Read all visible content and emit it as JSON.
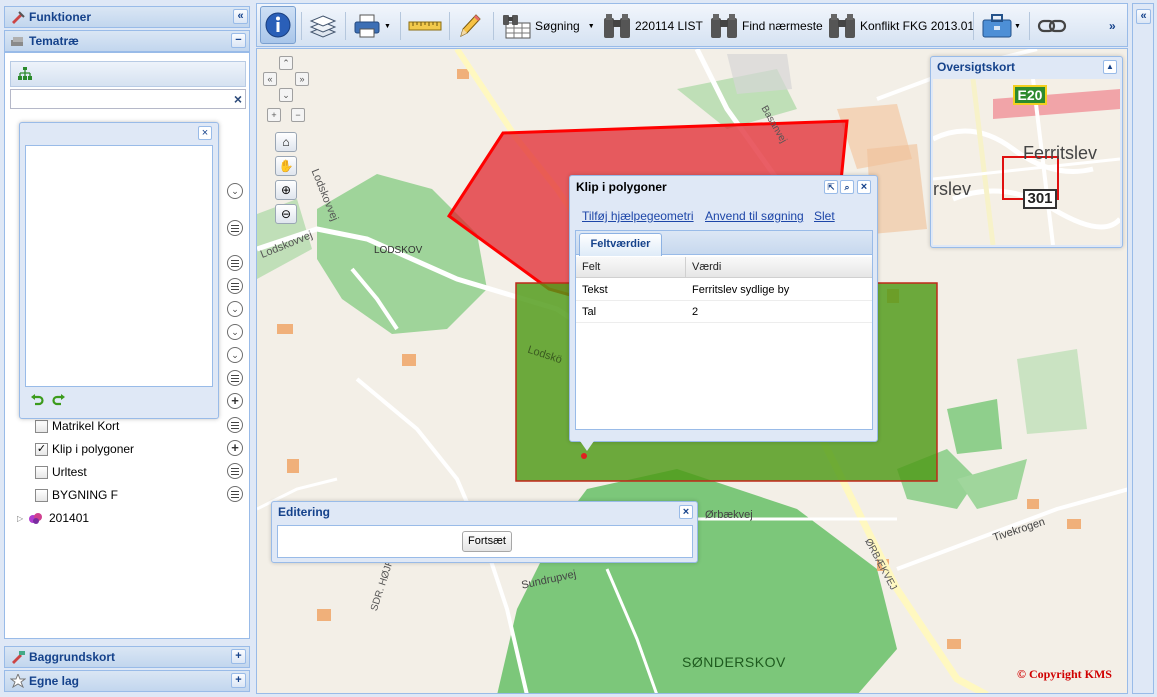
{
  "left_panel": {
    "funktioner": "Funktioner",
    "temaetrae": "Tematræ",
    "baggrundskort": "Baggrundskort",
    "egne_lag": "Egne lag",
    "layers": [
      {
        "label": "Matrikel Kort",
        "checked": false
      },
      {
        "label": "Klip i polygoner",
        "checked": true
      },
      {
        "label": "Urltest",
        "checked": false
      },
      {
        "label": "BYGNING F",
        "checked": false
      }
    ],
    "group": "201401",
    "clear_symbol": "×"
  },
  "toolbar": {
    "soegning": "Søgning",
    "list": "220114 LIST",
    "find": "Find nærmeste",
    "konflikt": "Konflikt FKG 2013.01",
    "more": "»"
  },
  "map": {
    "labels": {
      "lodskov": "LODSKOV",
      "lodskovvej": "Lodskovvej",
      "lodskov_road": "Lodskovvej",
      "lodsko": "Lodskö",
      "soenderskov": "SØNDERSKOV",
      "oerbaekvej": "Ørbækvej",
      "orbaekvej_caps": "ØRBÆKVEJ",
      "tivekrogen": "Tivekrogen",
      "hoejrupvejen": "SDR. HØJRUPVEJEN",
      "sundrupvej": "Sundrupvej",
      "basanvej": "Basanvej"
    },
    "copyright": "© Copyright KMS"
  },
  "overview": {
    "title": "Oversigtskort",
    "e20": "E20",
    "ferritslev": "Ferritslev",
    "rslev": "rslev",
    "road301": "301"
  },
  "klip": {
    "title": "Klip i polygoner",
    "links": [
      "Tilføj hjælpegeometri",
      "Anvend til søgning",
      "Slet"
    ],
    "tab": "Feltværdier",
    "columns": [
      "Felt",
      "Værdi"
    ],
    "rows": [
      [
        "Tekst",
        "Ferritslev sydlige by"
      ],
      [
        "Tal",
        "2"
      ]
    ]
  },
  "editering": {
    "title": "Editering",
    "button": "Fortsæt"
  },
  "colors": {
    "red_polygon": "#e0202a",
    "green_rect": "#4e9a16",
    "header_text": "#15428b"
  }
}
